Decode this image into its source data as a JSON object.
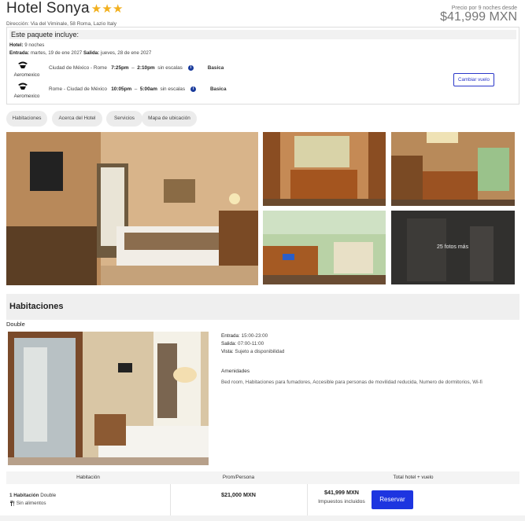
{
  "hotel": {
    "name": "Hotel Sonya",
    "stars": "★★★",
    "address": "Dirección: Via del Viminale, 58 Roma, Lazio Italy"
  },
  "price": {
    "note": "Precio por 9 noches desde",
    "amount": "$41,999 MXN"
  },
  "package": {
    "title": "Este paquete incluye:",
    "hotel_label": "Hotel:",
    "hotel_value": "9 noches",
    "checkin_label": "Entrada:",
    "checkin_value": "martes, 19 de ene 2027",
    "checkout_label": "Salida:",
    "checkout_value": "jueves, 28 de ene 2027",
    "flights": [
      {
        "airline": "Aeromexico",
        "route": "Ciudad de México - Rome",
        "depart": "7:25pm",
        "dash": "–",
        "arrive": "2:10pm",
        "stops": "sin escalas",
        "info": "i",
        "fare": "Basica"
      },
      {
        "airline": "Aeromexico",
        "route": "Rome - Ciudad de México",
        "depart": "10:05pm",
        "dash": "–",
        "arrive": "5:00am",
        "stops": "sin escalas",
        "info": "i",
        "fare": "Basica"
      }
    ],
    "change_flight": "Cambiar vuelo"
  },
  "tabs": [
    "Habitaciones",
    "Acerca del Hotel",
    "Servicios",
    "Mapa de ubicación"
  ],
  "gallery": {
    "more_photos": "25 fotos más"
  },
  "rooms": {
    "section_title": "Habitaciones",
    "room_type": "Double",
    "checkin_label": "Entrada:",
    "checkin_value": "15:00-23:00",
    "checkout_label": "Salida:",
    "checkout_value": "07:00-11:00",
    "view_label": "Vista:",
    "view_value": "Sujeto a disponibilidad",
    "amenities_title": "Amenidades",
    "amenities": "Bed room, Habitaciones para fumadores, Accesible para personas de movilidad reducida, Numero de dormitorios, Wi-fi"
  },
  "table": {
    "headers": [
      "Habitación",
      "Prom/Persona",
      "Total hotel + vuelo"
    ],
    "row": {
      "count": "1 Habitación",
      "type": "Double",
      "meal_icon": "utensils-icon",
      "meal": "Sin alimentos",
      "per_person": "$21,000 MXN",
      "total": "$41,999 MXN",
      "taxes": "Impuestos incluidos",
      "reserve": "Reservar"
    }
  },
  "colors": {
    "accent": "#1d35e0",
    "star": "#f2b01e",
    "info": "#1a3b9c"
  }
}
